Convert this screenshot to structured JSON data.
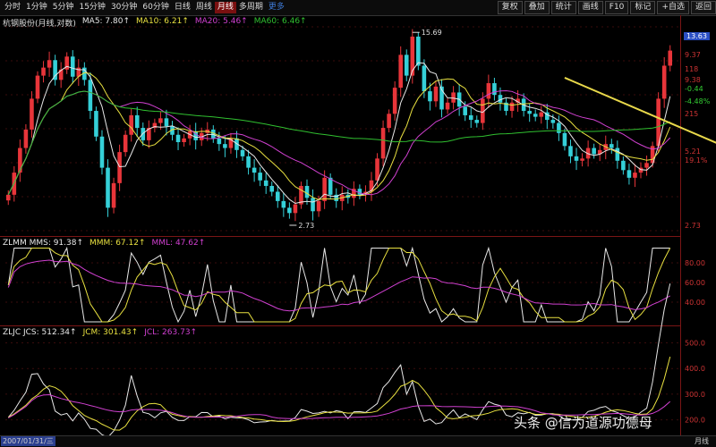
{
  "periods": [
    "分时",
    "1分钟",
    "5分钟",
    "15分钟",
    "30分钟",
    "60分钟",
    "日线",
    "周线",
    "月线",
    "多周期",
    "更多"
  ],
  "active_period": "月线",
  "tools": [
    "复权",
    "叠加",
    "统计",
    "画线",
    "F10",
    "标记",
    "+自选",
    "返回"
  ],
  "chart_data": [
    {
      "type": "candlestick",
      "panel": "main",
      "title": "杭钢股份(月线,对数)",
      "legend": [
        {
          "name": "MA5",
          "value": "7.80",
          "color": "#e8e8e8"
        },
        {
          "name": "MA10",
          "value": "6.21",
          "color": "#e8e040"
        },
        {
          "name": "MA20",
          "value": "5.46",
          "color": "#d040d0"
        },
        {
          "name": "MA60",
          "value": "6.46",
          "color": "#30c030"
        }
      ],
      "scale": "log",
      "ylim": [
        2.6,
        16.5
      ],
      "y_ticks": [
        "9.37",
        "118",
        "9.38",
        "-0.44",
        "-4.48%",
        "215",
        "5.21",
        "19.1%",
        "2.73"
      ],
      "price_badge": "13.63",
      "annotations": [
        {
          "text": "15.69",
          "index": 69,
          "price": 15.69
        },
        {
          "text": "2.73",
          "index": 48,
          "price": 2.73
        }
      ],
      "closes": [
        3.6,
        4.4,
        5.5,
        6.5,
        8.6,
        10.6,
        11.4,
        12.2,
        10.2,
        11.2,
        12.6,
        10.5,
        11.4,
        10.2,
        7.7,
        6.1,
        4.6,
        3.2,
        4.0,
        5.3,
        6.2,
        7.4,
        6.6,
        5.9,
        6.6,
        6.9,
        7.2,
        6.7,
        6.2,
        5.8,
        6.0,
        6.4,
        5.9,
        6.3,
        6.5,
        6.0,
        5.7,
        5.5,
        6.0,
        5.4,
        5.1,
        4.6,
        4.4,
        4.1,
        3.9,
        3.7,
        3.4,
        3.2,
        3.05,
        3.3,
        3.9,
        3.5,
        3.1,
        3.4,
        4.2,
        3.6,
        3.4,
        3.6,
        3.5,
        3.8,
        3.6,
        3.7,
        4.1,
        5.0,
        6.6,
        7.5,
        9.5,
        12.8,
        10.6,
        15.1,
        11.6,
        9.2,
        8.4,
        9.6,
        7.8,
        8.3,
        9.1,
        8.0,
        7.4,
        7.1,
        6.9,
        8.6,
        9.9,
        8.9,
        8.3,
        7.7,
        8.3,
        8.6,
        7.7,
        7.5,
        7.3,
        7.6,
        7.1,
        6.9,
        6.3,
        5.6,
        5.1,
        4.9,
        5.0,
        5.5,
        5.2,
        5.4,
        5.7,
        5.5,
        4.9,
        4.5,
        4.2,
        4.4,
        4.6,
        4.8,
        5.6,
        8.6,
        11.6,
        13.3
      ]
    },
    {
      "type": "line",
      "panel": "ZLMM",
      "legend": [
        {
          "name": "ZLMM MMS",
          "value": "91.38",
          "color": "#e8e8e8"
        },
        {
          "name": "MMM",
          "value": "67.12",
          "color": "#e8e040"
        },
        {
          "name": "MML",
          "value": "47.62",
          "color": "#d040d0"
        }
      ],
      "ylim": [
        20,
        100
      ],
      "y_ticks": [
        "80.00",
        "60.00",
        "40.00"
      ]
    },
    {
      "type": "line",
      "panel": "ZLJC",
      "legend": [
        {
          "name": "ZLJC JCS",
          "value": "512.34",
          "color": "#e8e8e8"
        },
        {
          "name": "JCM",
          "value": "301.43",
          "color": "#e8e040"
        },
        {
          "name": "JCL",
          "value": "263.73",
          "color": "#d040d0"
        }
      ],
      "ylim": [
        150,
        540
      ],
      "y_ticks": [
        "500.0",
        "400.0",
        "300.0",
        "200.0"
      ]
    }
  ],
  "trendline": {
    "from": {
      "index": 95,
      "price": 10.4
    },
    "to": {
      "index": 128,
      "price": 4.9
    },
    "color": "#e8d84a"
  },
  "footer": {
    "date": "2007/01/31/三",
    "y_label": "月线"
  },
  "watermark": "头条 @信为道源功德母"
}
